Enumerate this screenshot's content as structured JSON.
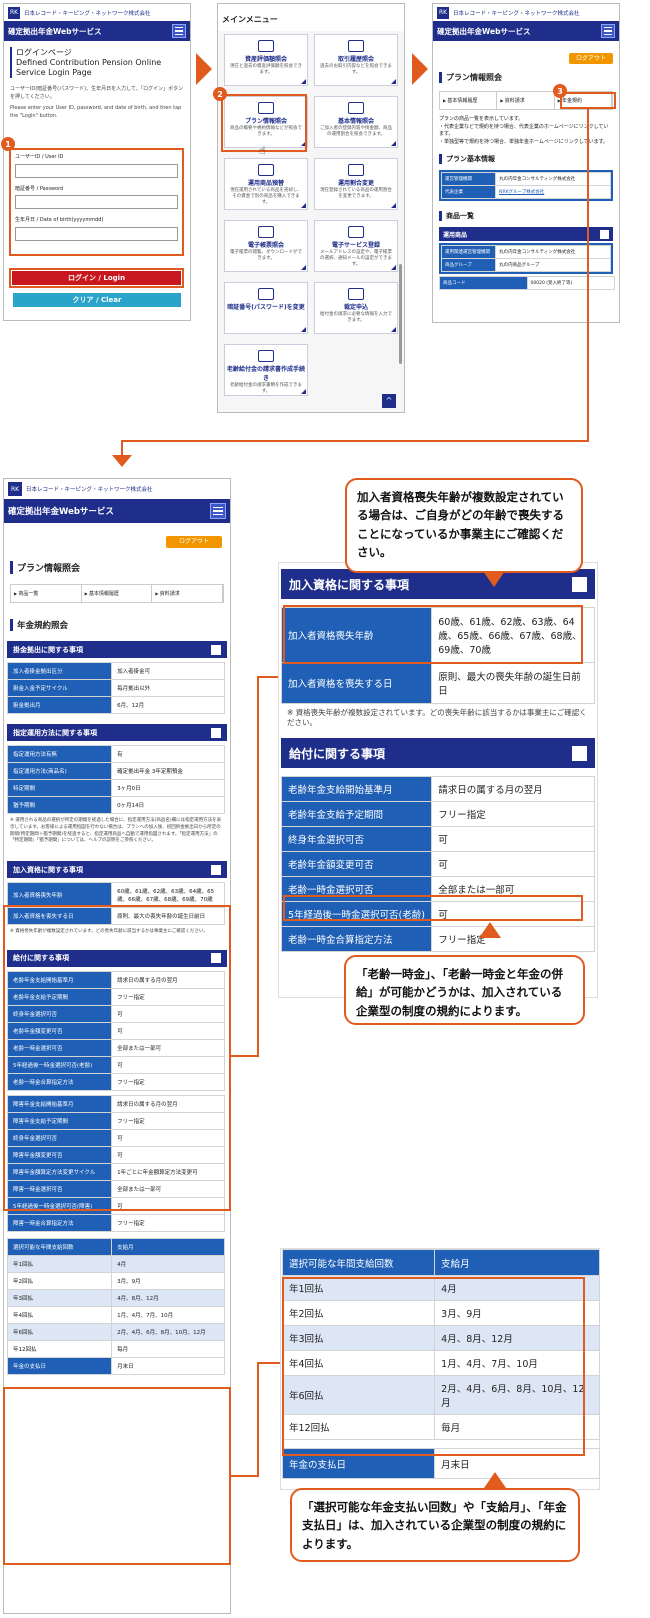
{
  "common": {
    "company": "日本レコード・キーピング・ネットワーク株式会社",
    "service_title": "確定拠出年金Webサービス",
    "logout": "ログアウト"
  },
  "screen1": {
    "heading": "ログインページ",
    "heading_en": "Defined Contribution Pension Online Service Login Page",
    "intro_jp": "ユーザーID(暗証番号(パスワード)、生年月日を入力して、「ログイン」ボタンを押してください。",
    "intro_en": "Please enter your User ID, password, and date of birth, and then tap the \"Login\" button.",
    "user_id_label": "ユーザーID / User ID",
    "password_label": "暗証番号 / Password",
    "dob_label": "生年月日 / Date of birth(yyyymmdd)",
    "login_button": "ログイン / Login",
    "clear_button": "クリア / Clear",
    "badge": "1"
  },
  "screen2": {
    "title": "メインメニュー",
    "badge": "2",
    "tiles": [
      {
        "t": "資産評価額照会",
        "d": "現在と過去の資産評価額を照会できます。"
      },
      {
        "t": "取引履歴照会",
        "d": "過去のお取引内容などを照会できます。"
      },
      {
        "t": "プラン情報照会",
        "d": "商品の概要や規約情報などが照会できます。"
      },
      {
        "t": "基本情報照会",
        "d": "ご加入者の登録内容や掛金額、商品の運用割合を照会できます。"
      },
      {
        "t": "運用商品預替",
        "d": "現在運用されている商品を売却し、その資金で別の商品を購入できます。"
      },
      {
        "t": "運用割合変更",
        "d": "現在登録されている商品の運用割合を変更できます。"
      },
      {
        "t": "電子帳票照会",
        "d": "電子帳票の閲覧、ダウンロードができます。"
      },
      {
        "t": "電子サービス登録",
        "d": "メールアドレスの設定や、電子帳票の選択、通知メールの設定ができます。"
      },
      {
        "t": "暗証番号(パスワード)を変更",
        "d": ""
      },
      {
        "t": "裁定申込",
        "d": "給付金の請求に必要な情報を入力できます。"
      },
      {
        "t": "老齢給付金の請求書作成手続き",
        "d": "老齢給付金の請求書類を作成できます。"
      }
    ]
  },
  "screen3": {
    "section": "プラン情報照会",
    "badge": "3",
    "crumbs": [
      "基本情報履歴",
      "資料請求",
      "年金規約"
    ],
    "desc": "プランの商品一覧を表示しています。",
    "notes": [
      "・代表企業などで規約を持つ場合、代表企業のホームページにリンクしています。",
      "・単独型等で規約を持つ場合、単独年金ホームページにリンクしています。"
    ],
    "basic_title": "プラン基本情報",
    "basic_rows": [
      [
        "運営管理機関",
        "丸の内年金コンサルティング株式会社"
      ],
      [
        "代表企業",
        "NRKグループ株式会社"
      ]
    ],
    "products_title": "商品一覧",
    "products_bar": "運用商品",
    "product_rows": [
      [
        "運用関連運営管理機関",
        "丸の内年金コンサルティング株式会社"
      ],
      [
        "商品グループ",
        "丸の内商品グループ"
      ],
      [
        "商品コード",
        "00020 (受入終了等)"
      ]
    ]
  },
  "screen4": {
    "section": "プラン情報照会",
    "crumbs": [
      "商品一覧",
      "基本情報履歴",
      "資料請求"
    ],
    "title": "年金規約照会",
    "kakekin_bar": "掛金拠出に関する事項",
    "kakekin_rows": [
      [
        "加入者掛金拠出区分",
        "加入者掛金可"
      ],
      [
        "掛金入金予定サイクル",
        "毎月拠出以外"
      ],
      [
        "掛金拠出月",
        "6月、12月"
      ]
    ],
    "shitei_bar": "指定運用方法に関する事項",
    "shitei_rows": [
      [
        "指定運用方法有無",
        "有"
      ],
      [
        "指定運用方法(商品名)",
        "確定拠出年金 3年定期預金"
      ],
      [
        "特定期間",
        "3ヶ月0日"
      ],
      [
        "猶予期間",
        "0ヶ月14日"
      ]
    ],
    "shitei_note": "※ 運用される商品の選択が所定の期間を経過した場合に、指定運用方法(商品名)欄には指定運用方法を表示しています。お客様による運用指図を行わない場合は、プランへの加入後、初回掛金拠出日から所定の期間(特定期間＋猶予期間)を経過すると、指定運用商品へ自動で運用指図されます。「指定運用方法」の「特定期間」「猶予期間」については、ヘルプの説明をご参照ください。",
    "shikaku_bar": "加入資格に関する事項",
    "shikaku_rows": [
      [
        "加入者資格喪失年齢",
        "60歳、61歳、62歳、63歳、64歳、65歳、66歳、67歳、68歳、69歳、70歳"
      ],
      [
        "加入者資格を喪失する日",
        "原則、最大の喪失年齢の誕生日前日"
      ]
    ],
    "shikaku_note": "※ 資格喪失年齢が複数設定されています。どの喪失年齢に該当するかは事業主にご確認ください。",
    "kyufu_bar": "給付に関する事項",
    "kyufu_rows": [
      [
        "老齢年金支給開始基準月",
        "請求日の属する月の翌月"
      ],
      [
        "老齢年金支給予定期間",
        "フリー指定"
      ],
      [
        "終身年金選択可否",
        "可"
      ],
      [
        "老齢年金額変更可否",
        "可"
      ],
      [
        "老齢一時金選択可否",
        "全部または一部可"
      ],
      [
        "5年経過後一時金選択可否(老齢)",
        "可"
      ],
      [
        "老齢一時金合算指定方法",
        "フリー指定"
      ]
    ],
    "shogai_rows": [
      [
        "障害年金支給開始基準月",
        "請求日の属する月の翌月"
      ],
      [
        "障害年金支給予定期間",
        "フリー指定"
      ],
      [
        "終身年金選択可否",
        "可"
      ],
      [
        "障害年金額変更可否",
        "可"
      ],
      [
        "障害年金額算定方法変更サイクル",
        "1年ごとに年金額算定方法変更可"
      ],
      [
        "障害一時金選択可否",
        "全部または一部可"
      ],
      [
        "5年経過後一時金選択可否(障害)",
        "可"
      ],
      [
        "障害一時金合算指定方法",
        "フリー指定"
      ]
    ],
    "pay_header": [
      "選択可能な年間支給回数",
      "支給月"
    ],
    "pay_rows": [
      [
        "年1回払",
        "4月"
      ],
      [
        "年2回払",
        "3月、9月"
      ],
      [
        "年3回払",
        "4月、8月、12月"
      ],
      [
        "年4回払",
        "1月、4月、7月、10月"
      ],
      [
        "年6回払",
        "2月、4月、6月、8月、10月、12月"
      ],
      [
        "年12回払",
        "毎月"
      ]
    ],
    "pay_day": [
      "年金の支払日",
      "月末日"
    ]
  },
  "zoom1": {
    "bar": "加入資格に関する事項",
    "rows": [
      [
        "加入者資格喪失年齢",
        "60歳、61歳、62歳、63歳、64歳、65歳、66歳、67歳、68歳、69歳、70歳"
      ],
      [
        "加入者資格を喪失する日",
        "原則、最大の喪失年齢の誕生日前日"
      ]
    ],
    "note": "※ 資格喪失年齢が複数設定されています。どの喪失年齢に該当するかは事業主にご確認ください。",
    "kyufu_bar": "給付に関する事項",
    "kyufu_rows": [
      [
        "老齢年金支給開始基準月",
        "請求日の属する月の翌月"
      ],
      [
        "老齢年金支給予定期間",
        "フリー指定"
      ],
      [
        "終身年金選択可否",
        "可"
      ],
      [
        "老齢年金額変更可否",
        "可"
      ],
      [
        "老齢一時金選択可否",
        "全部または一部可"
      ],
      [
        "5年経過後一時金選択可否(老齢)",
        "可"
      ],
      [
        "老齢一時金合算指定方法",
        "フリー指定"
      ]
    ]
  },
  "zoom2": {
    "header": [
      "選択可能な年間支給回数",
      "支給月"
    ],
    "rows": [
      [
        "年1回払",
        "4月"
      ],
      [
        "年2回払",
        "3月、9月"
      ],
      [
        "年3回払",
        "4月、8月、12月"
      ],
      [
        "年4回払",
        "1月、4月、7月、10月"
      ],
      [
        "年6回払",
        "2月、4月、6月、8月、10月、12月"
      ],
      [
        "年12回払",
        "毎月"
      ]
    ],
    "pay_day": [
      "年金の支払日",
      "月末日"
    ]
  },
  "callouts": {
    "c1": "加入者資格喪失年齢が複数設定されている場合は、ご自身がどの年齢で喪失することになっているか事業主にご確認ください。",
    "c2": "「老齢一時金」、「老齢一時金と年金の併給」が可能かどうかは、加入されている企業型の制度の規約によります。",
    "c3": "「選択可能な年金支払い回数」や「支給月」、「年金支払日」は、加入されている企業型の制度の規約によります。"
  }
}
